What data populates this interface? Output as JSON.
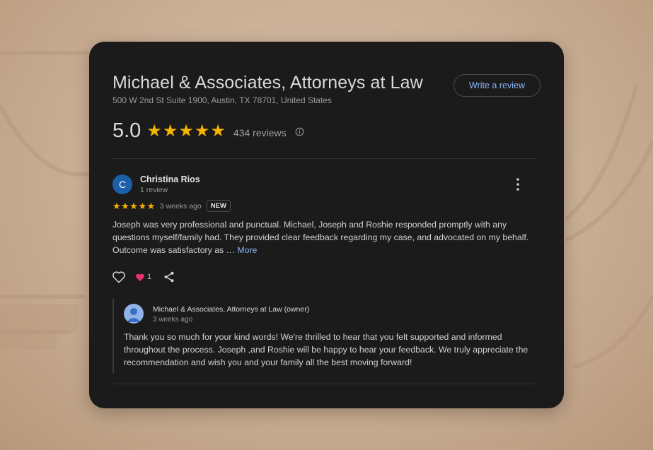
{
  "business": {
    "name": "Michael & Associates, Attorneys at Law",
    "address": "500 W 2nd St Suite 1900, Austin, TX 78701, United States",
    "write_review_label": "Write a review",
    "rating": "5.0",
    "stars": "★★★★★",
    "review_count": "434 reviews"
  },
  "review": {
    "avatar_letter": "C",
    "reviewer_name": "Christina Rios",
    "reviewer_meta": "1 review",
    "stars": "★★★★★",
    "time_ago": "3 weeks ago",
    "badge": "NEW",
    "text": "Joseph was very professional and punctual. Michael, Joseph and Roshie responded promptly with any questions myself/family had. They provided clear feedback regarding my case, and advocated on my behalf. Outcome was satisfactory as …",
    "more_label": "More",
    "like_count": "1"
  },
  "owner_reply": {
    "name": "Michael & Associates, Attorneys at Law (owner)",
    "time_ago": "3 weeks ago",
    "text": "Thank you so much for your kind words! We're thrilled to hear that you felt supported and informed throughout the process. Joseph ,and Roshie will be happy to hear your feedback. We truly appreciate the recommendation and wish you and your family all the best moving forward!"
  },
  "colors": {
    "card_bg": "#1b1b1c",
    "star": "#f5b400",
    "link": "#8ab4f8",
    "avatar": "#1a5fa8",
    "heart_filled": "#e8336a"
  },
  "icons": [
    "info-icon",
    "more-vert-icon",
    "heart-outline-icon",
    "heart-filled-icon",
    "share-icon",
    "owner-avatar-icon"
  ]
}
